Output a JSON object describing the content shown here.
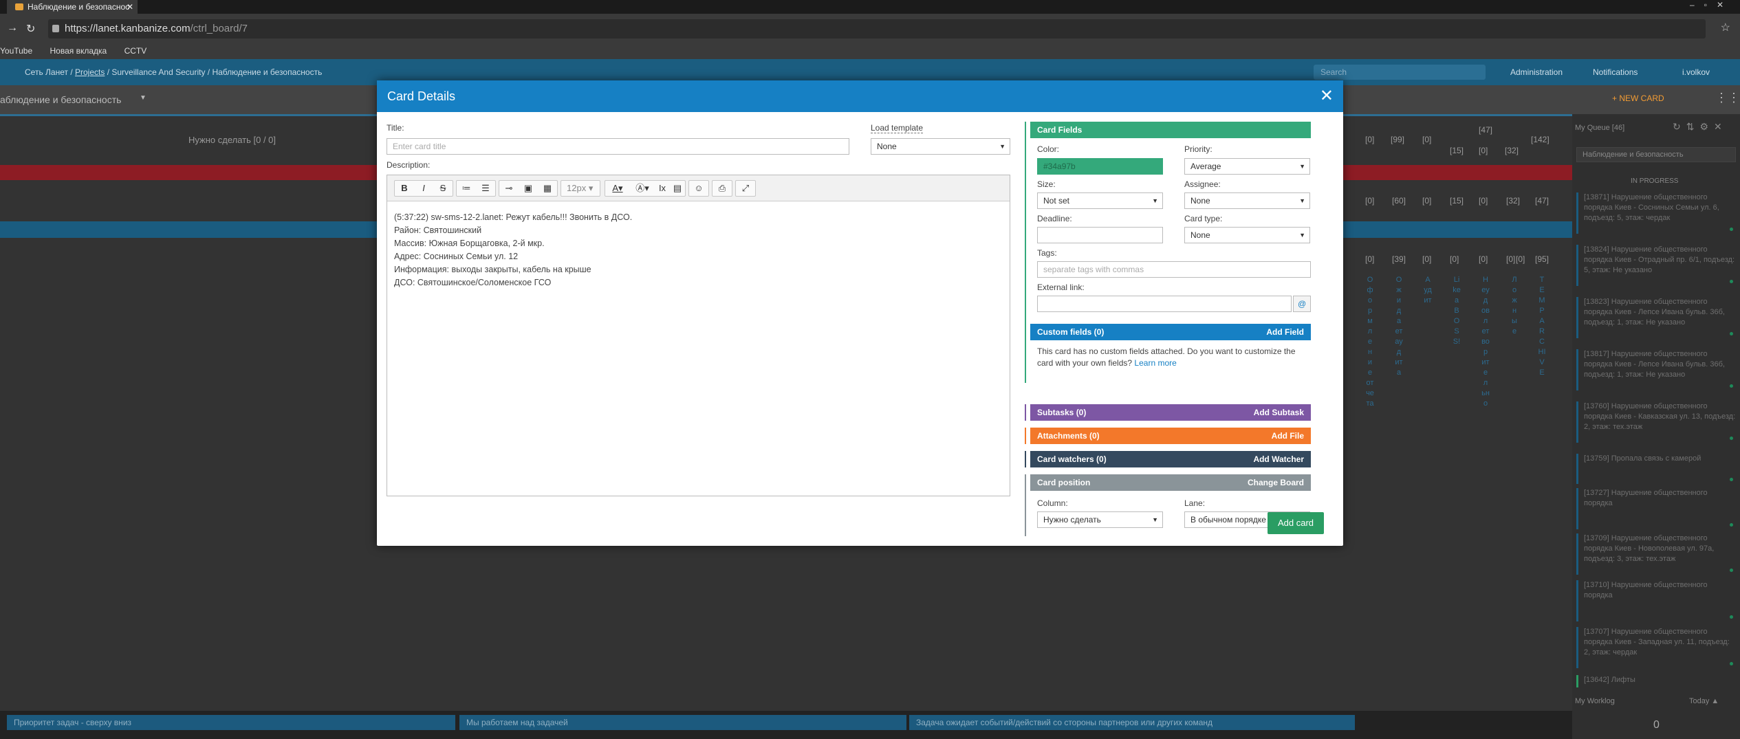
{
  "browser": {
    "tab_title": "Наблюдение и безопаснос",
    "url_host": "https://lanet.kanbanize.com",
    "url_path": "/ctrl_board/7",
    "bookmarks": [
      "YouTube",
      "Новая вкладка",
      "CCTV"
    ]
  },
  "app": {
    "breadcrumb": {
      "root": "Сеть Ланет",
      "projects": "Projects",
      "rest": "Surveillance And Security / Наблюдение и безопасность"
    },
    "search_placeholder": "Search",
    "nav": {
      "admin": "Administration",
      "notifications": "Notifications",
      "user": "i.volkov"
    },
    "board_title": "аблюдение и безопасность",
    "new_card": "NEW CARD"
  },
  "board": {
    "col_todo": "Нужно сделать [0 / 0]",
    "counts_top": [
      "[0]",
      "[99]",
      "[0]",
      "[47]",
      "[142]"
    ],
    "counts_sub": [
      "[15]",
      "[0]",
      "[32]"
    ],
    "counts_row2": [
      "[0]",
      "[60]",
      "[0]",
      "[15]",
      "[0]",
      "[32]",
      "[47]"
    ],
    "counts_row3": [
      "[0]",
      "[39]",
      "[0]",
      "[0]",
      "[0]",
      "[0]",
      "[0]",
      "[95]"
    ],
    "vertical_labels": [
      "Оформление отчета",
      "Ожидает аудита",
      "Аудит",
      "Like a BOSS!",
      "Неудовлетворительно",
      "Ложные",
      "TEMP ARCHIVE"
    ],
    "footer": [
      "Приоритет задач - сверху вниз",
      "Мы работаем над задачей",
      "Задача ожидает событий/действий со стороны партнеров или других команд"
    ]
  },
  "queue": {
    "title": "My Queue [46]",
    "board_select": "Наблюдение и безопасность",
    "section": "IN PROGRESS",
    "items": [
      "[13871] Нарушение общественного порядка Киев - Сосниных Семьи ул. 6, подъезд: 5, этаж: чердак",
      "[13824] Нарушение общественного порядка Киев - Отрадный пр. 6/1, подъезд: 5, этаж: Не указано",
      "[13823] Нарушение общественного порядка Киев - Лепсе Ивана бульв. 36б, подъезд: 1, этаж: Не указано",
      "[13817] Нарушение общественного порядка Киев - Лепсе Ивана бульв. 36б, подъезд: 1, этаж: Не указано",
      "[13760] Нарушение общественного порядка Киев - Кавказская ул. 13, подъезд: 2, этаж: тех.этаж",
      "[13759] Пропала связь с камерой",
      "[13727] Нарушение общественного порядка",
      "[13709] Нарушение общественного порядка Киев - Новополевая ул. 97а, подъезд: 3, этаж: тех.этаж",
      "[13710] Нарушение общественного порядка",
      "[13707] Нарушение общественного порядка Киев - Западная ул. 11, подъезд: 2, этаж: чердак",
      "[13642] Лифты"
    ],
    "worklog": "My Worklog",
    "today": "Today ▲",
    "worklog_value": "0"
  },
  "modal": {
    "title": "Card Details",
    "title_label": "Title:",
    "title_placeholder": "Enter card title",
    "load_template_label": "Load template",
    "load_template_value": "None",
    "description_label": "Description:",
    "font_size": "12px",
    "description_lines": [
      "(5:37:22) sw-sms-12-2.lanet: Режут кабель!!! Звонить в ДСО.",
      "Район: Святошинский",
      "Массив: Южная Борщаговка, 2-й мкр.",
      "Адрес: Сосниных Семьи ул. 12",
      "Информация: выходы закрыты, кабель на крыше",
      "ДСО: Святошинское/Соломенское ГСО"
    ],
    "fields": {
      "header": "Card Fields",
      "color_label": "Color:",
      "color_value": "#34a97b",
      "priority_label": "Priority:",
      "priority_value": "Average",
      "size_label": "Size:",
      "size_value": "Not set",
      "assignee_label": "Assignee:",
      "assignee_value": "None",
      "deadline_label": "Deadline:",
      "card_type_label": "Card type:",
      "card_type_value": "None",
      "tags_label": "Tags:",
      "tags_placeholder": "separate tags with commas",
      "external_link_label": "External link:",
      "at_icon": "@"
    },
    "custom_fields": {
      "label": "Custom fields (0)",
      "action": "Add Field",
      "note": "This card has no custom fields attached. Do you want to customize the card with your own fields?",
      "learn_more": "Learn more"
    },
    "subtasks": {
      "label": "Subtasks (0)",
      "action": "Add Subtask"
    },
    "attachments": {
      "label": "Attachments (0)",
      "action": "Add File"
    },
    "watchers": {
      "label": "Card watchers (0)",
      "action": "Add Watcher"
    },
    "position": {
      "label": "Card position",
      "action": "Change Board",
      "column_label": "Column:",
      "column_value": "Нужно сделать",
      "lane_label": "Lane:",
      "lane_value": "В обычном порядке"
    },
    "add_card": "Add card",
    "colors": {
      "fields": "#34a97b",
      "custom": "#1680c4",
      "subtasks": "#7d57a4",
      "attachments": "#f3782a",
      "watchers": "#34495e",
      "position": "#8a9499"
    }
  }
}
